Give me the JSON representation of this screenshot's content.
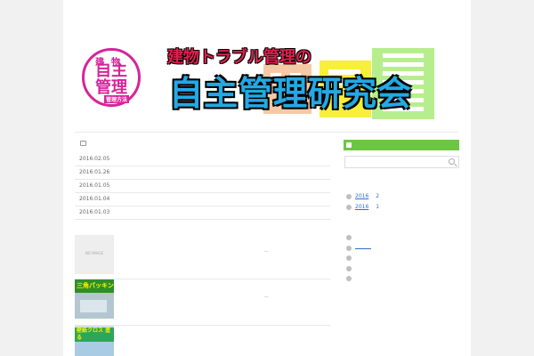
{
  "banner": {
    "seal": {
      "top": "建物",
      "mid": "自主",
      "bottom": "管理",
      "tag": "管理方法"
    },
    "subtitle": "建物トラブル管理の",
    "title": "自主管理研究会"
  },
  "main": {
    "dates": [
      "2016.02.05",
      "2016.01.26",
      "2016.01.05",
      "2016.01.04",
      "2016.01.03"
    ],
    "posts": [
      {
        "thumb_text": "NO IMAGE",
        "excerpt": "..."
      },
      {
        "thumb_text": "三角パッキン",
        "excerpt": "..."
      },
      {
        "thumb_text": "壁紙クロス 塗る",
        "excerpt": ""
      }
    ]
  },
  "sidebar": {
    "header_color": "#6cc644",
    "search": {
      "placeholder": ""
    },
    "archives": [
      {
        "year": "2016",
        "count": "2"
      },
      {
        "year": "2016",
        "count": "1"
      }
    ],
    "categories": [
      {
        "label": ""
      },
      {
        "label": ""
      },
      {
        "label": ""
      },
      {
        "label": ""
      },
      {
        "label": ""
      }
    ]
  }
}
